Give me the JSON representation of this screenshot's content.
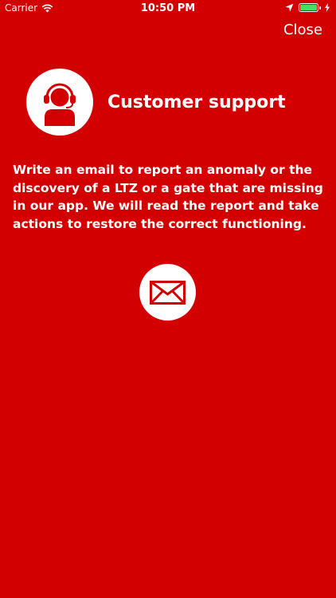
{
  "status_bar": {
    "carrier": "Carrier",
    "time": "10:50 PM",
    "battery_color": "#4cd964"
  },
  "header": {
    "close_label": "Close",
    "title": "Customer support",
    "avatar_icon": "headset-agent-icon"
  },
  "body": {
    "description": "Write an email to report an anomaly or the discovery of a LTZ or a gate that are missing in our app. We will read the report and take actions to restore the correct functioning."
  },
  "actions": {
    "email_icon": "envelope-icon"
  },
  "colors": {
    "background": "#d20000",
    "foreground": "#ffffff"
  }
}
